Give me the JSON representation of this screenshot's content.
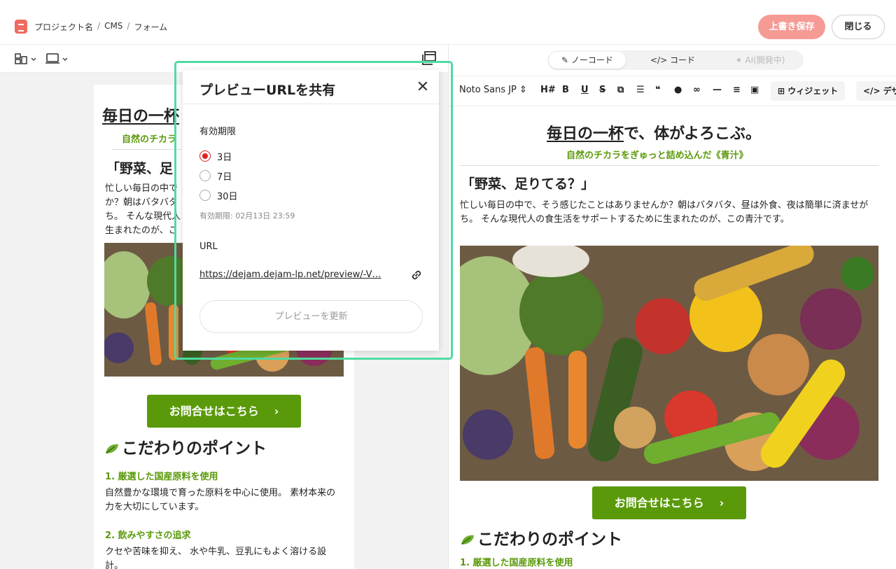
{
  "header": {
    "breadcrumb": [
      "プロジェクト名",
      "CMS",
      "フォーム"
    ],
    "breadcrumb_sep": "/",
    "save_label": "上書き保存",
    "close_label": "閉じる"
  },
  "right_panel": {
    "mode_tabs": [
      {
        "label": "ノーコード",
        "active": true
      },
      {
        "label": "コード",
        "active": false
      },
      {
        "label": "AI(開発中)",
        "active": false,
        "disabled": true
      }
    ],
    "format_bar": {
      "font": "Noto Sans JP",
      "heading": "H#",
      "bold": "B",
      "underline": "U",
      "widget_label": "ウィジェット",
      "design_label": "デザ"
    }
  },
  "article": {
    "title_underlined": "毎日の一杯",
    "title_rest": "で、体がよろこぶ。",
    "subtitle": "自然のチカラをぎゅっと詰め込んだ《青汁》",
    "heading": "「野菜、足りてる？」",
    "paragraph": "忙しい毎日の中で、そう感じたことはありませんか？朝はバタバタ、昼は外食、夜は簡単に済ませがち。 そんな現代人の食生活をサポートするために生まれたのが、この青汁です。",
    "cta_label": "お問合せはこちら",
    "cta_arrow": "›",
    "section_title": "こだわりのポイント",
    "points": [
      {
        "title": "1. 厳選した国産原料を使用",
        "body": "自然豊かな環境で育った原料を中心に使用。 素材本来の力を大切にしています。"
      },
      {
        "title": "2. 飲みやすさの追求",
        "body": "クセや苦味を抑え、 水や牛乳、豆乳にもよく溶ける設計。"
      }
    ]
  },
  "left_preview": {
    "title_visible": "毎日の一杯",
    "subtitle_visible": "自然のチカラ",
    "heading_visible": "「野菜、足",
    "paragraph_visible": [
      "忙しい毎日の中で",
      "か？朝はバタバタ",
      "ち。 そんな現代人",
      "生まれたのが、こ"
    ]
  },
  "share_popup": {
    "title": "プレビューURLを共有",
    "expiry_label": "有効期限",
    "options": [
      {
        "label": "3日",
        "selected": true
      },
      {
        "label": "7日",
        "selected": false
      },
      {
        "label": "30日",
        "selected": false
      }
    ],
    "expiry_note": "有効期限: 02月13日 23:59",
    "url_label": "URL",
    "url_value": "https://dejam.dejam-lp.net/preview/-V…",
    "refresh_label": "プレビューを更新"
  },
  "colors": {
    "brand_green": "#5a9a0a",
    "save_button": "#f59a95",
    "popup_highlight": "#4fdba0",
    "radio_selected": "#dd2222"
  }
}
